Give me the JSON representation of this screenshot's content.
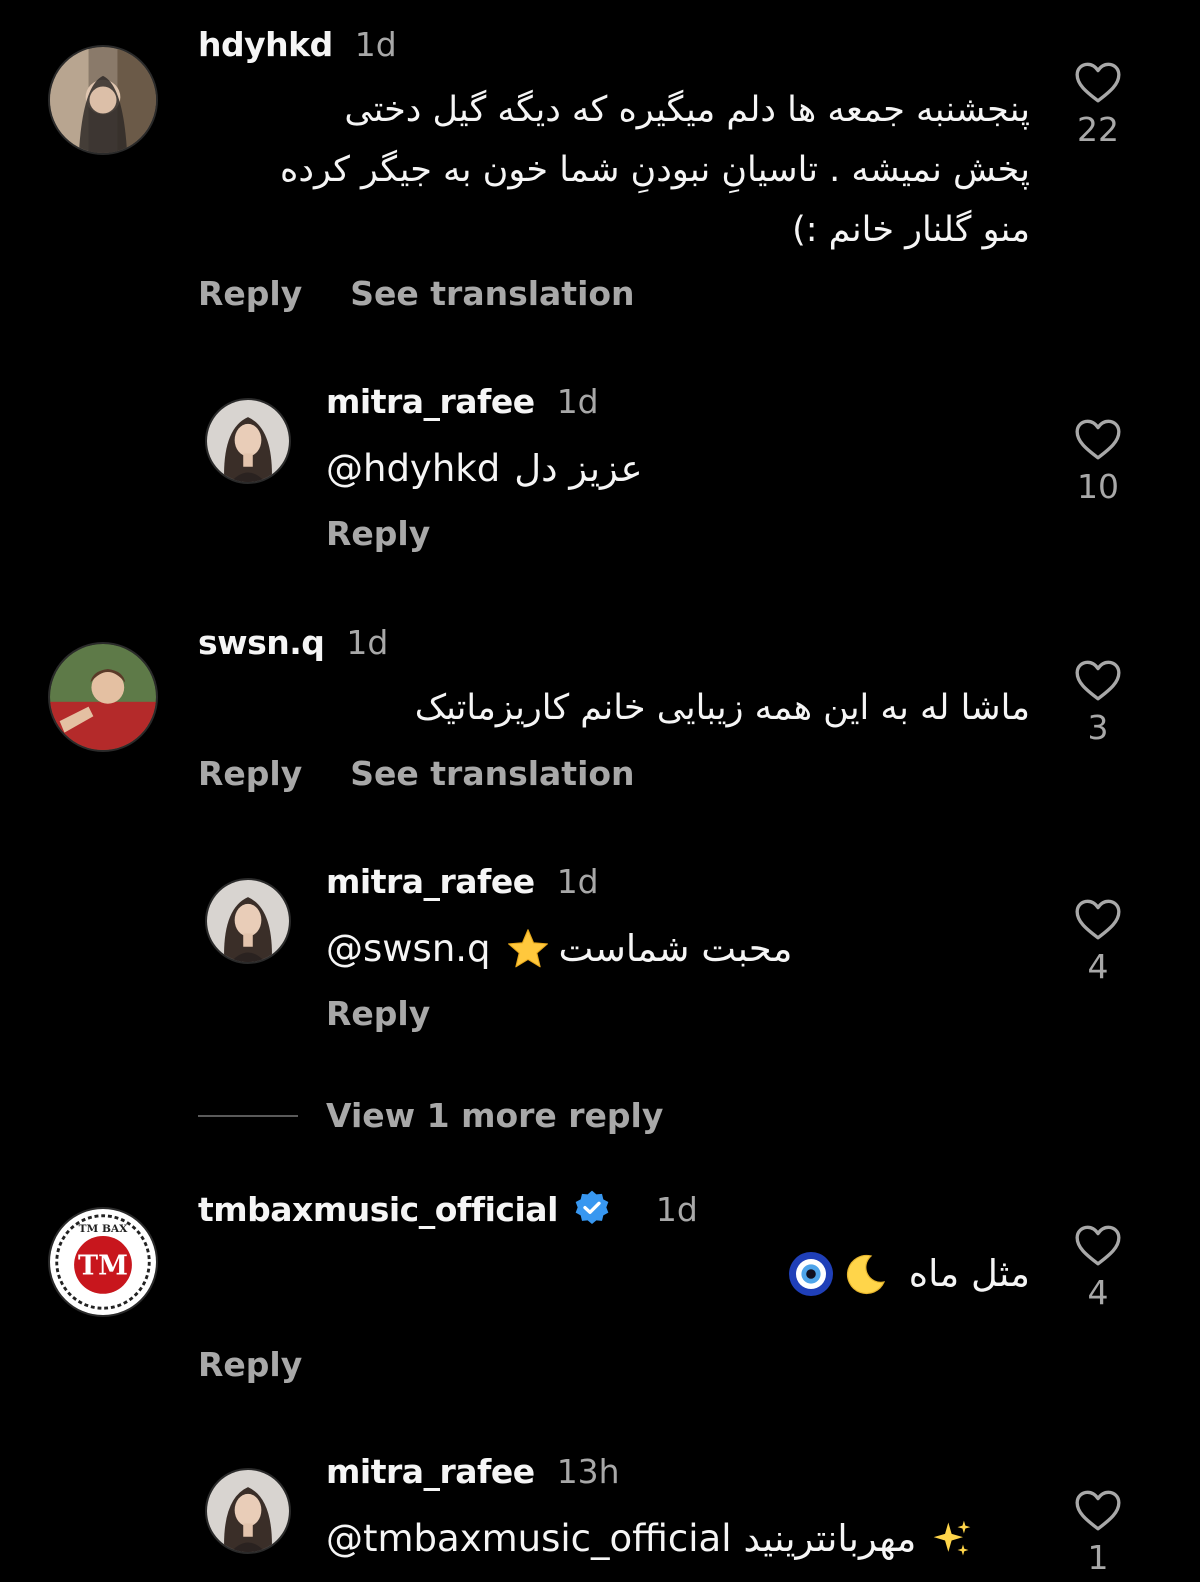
{
  "comments": [
    {
      "username": "hdyhkd",
      "time": "1d",
      "text_lines": [
        "پنجشنبه جمعه ها دلم میگیره که دیگه گیل دختی",
        "پخش نمیشه . تاسیانِ نبودنِ شما خون به جیگر کرده",
        "منو گلنار خانم :)"
      ],
      "reply_label": "Reply",
      "translate_label": "See translation",
      "likes": "22"
    },
    {
      "username": "mitra_rafee",
      "time": "1d",
      "mention": "@hdyhkd",
      "text": "عزیز دل",
      "reply_label": "Reply",
      "likes": "10"
    },
    {
      "username": "swsn.q",
      "time": "1d",
      "text": "ماشا له به این همه زیبایی خانم کاریزماتیک",
      "reply_label": "Reply",
      "translate_label": "See translation",
      "likes": "3"
    },
    {
      "username": "mitra_rafee",
      "time": "1d",
      "mention": "@swsn.q",
      "text": "محبت شماست",
      "emoji": "star-emoji",
      "reply_label": "Reply",
      "likes": "4"
    },
    {
      "username": "tmbaxmusic_official",
      "time": "1d",
      "verified": true,
      "text": "مثل ماه",
      "emoji": "moon-and-nazar-emoji",
      "reply_label": "Reply",
      "likes": "4"
    },
    {
      "username": "mitra_rafee",
      "time": "13h",
      "mention": "@tmbaxmusic_official",
      "text": "مهربانترینید",
      "emoji": "sparkles-emoji",
      "likes": "1"
    }
  ],
  "view_more": "View 1 more reply",
  "colors": {
    "background": "#000000",
    "primary_text": "#f5f5f5",
    "secondary_text": "#a8a8a8",
    "verified_blue": "#3897f0"
  }
}
